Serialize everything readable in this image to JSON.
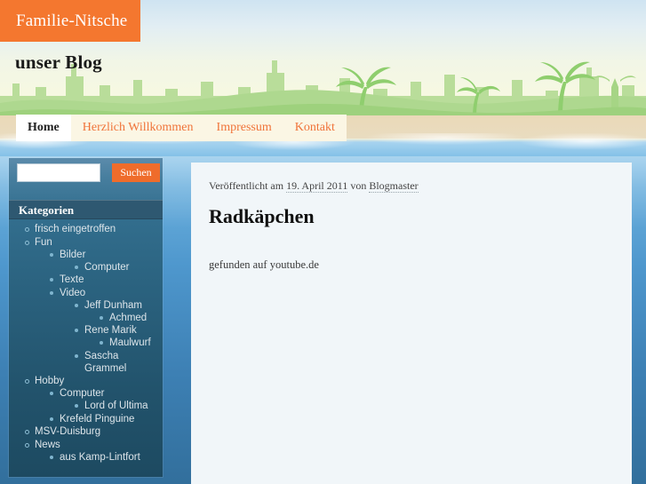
{
  "site": {
    "brand": "Familie-Nitsche",
    "tagline": "unser Blog"
  },
  "nav": {
    "items": [
      {
        "label": "Home",
        "active": true
      },
      {
        "label": "Herzlich Willkommen",
        "active": false
      },
      {
        "label": "Impressum",
        "active": false
      },
      {
        "label": "Kontakt",
        "active": false
      }
    ]
  },
  "sidebar": {
    "search": {
      "value": "",
      "placeholder": "",
      "button_label": "Suchen"
    },
    "categories_heading": "Kategorien",
    "categories": [
      {
        "label": "frisch eingetroffen"
      },
      {
        "label": "Fun",
        "children": [
          {
            "label": "Bilder",
            "children": [
              {
                "label": "Computer"
              }
            ]
          },
          {
            "label": "Texte"
          },
          {
            "label": "Video",
            "children": [
              {
                "label": "Jeff Dunham",
                "children": [
                  {
                    "label": "Achmed"
                  }
                ]
              },
              {
                "label": "Rene Marik",
                "children": [
                  {
                    "label": "Maulwurf"
                  }
                ]
              },
              {
                "label": "Sascha Grammel"
              }
            ]
          }
        ]
      },
      {
        "label": "Hobby",
        "children": [
          {
            "label": "Computer",
            "children": [
              {
                "label": "Lord of Ultima"
              }
            ]
          },
          {
            "label": "Krefeld Pinguine"
          }
        ]
      },
      {
        "label": "MSV-Duisburg"
      },
      {
        "label": "News",
        "children": [
          {
            "label": "aus Kamp-Lintfort"
          }
        ]
      }
    ]
  },
  "post": {
    "meta_prefix": "Veröffentlicht am",
    "date": "19. April 2011",
    "meta_by": "von",
    "author": "Blogmaster",
    "title": "Radkäpchen",
    "body": "gefunden auf youtube.de"
  },
  "colors": {
    "brand_orange": "#f4772f",
    "nav_link": "#f0743a",
    "nav_tab_bg": "#fbf6e4",
    "sidebar_heading_bg": "#2e5871",
    "content_bg": "#f1f6f9",
    "search_button": "#ef6c2b"
  }
}
